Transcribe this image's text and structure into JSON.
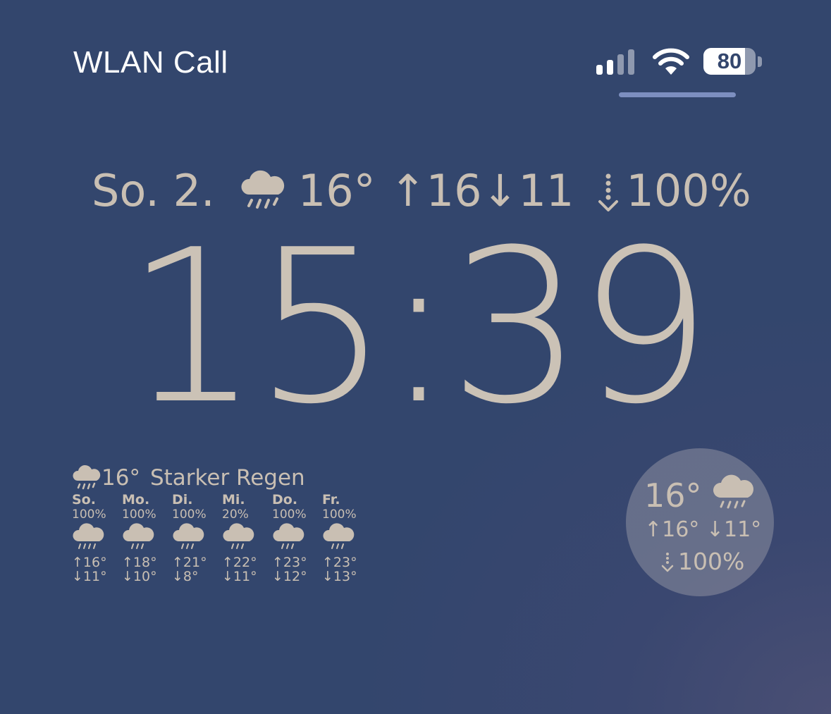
{
  "status_bar": {
    "carrier": "WLAN Call",
    "signal_bars_active": 2,
    "signal_bars_total": 4,
    "battery_level": "80",
    "battery_fraction": 0.8,
    "icons": [
      "cellular-signal-icon",
      "wifi-icon",
      "battery-icon"
    ]
  },
  "top_widget": {
    "date": "So. 2.",
    "icon": "cloud-rain-icon",
    "temp": "16°",
    "high": "↑16",
    "low": "↓11",
    "precip": "100%",
    "precip_icon": "precipitation-arrow-icon"
  },
  "clock": {
    "time": "15:39"
  },
  "forecast_widget": {
    "current_temp": "16°",
    "condition": "Starker Regen",
    "icon": "cloud-rain-icon",
    "days": [
      {
        "day": "So.",
        "precip": "100%",
        "high": "↑16°",
        "low": "↓11°",
        "icon": "cloud-heavy-rain-icon"
      },
      {
        "day": "Mo.",
        "precip": "100%",
        "high": "↑18°",
        "low": "↓10°",
        "icon": "cloud-rain-icon"
      },
      {
        "day": "Di.",
        "precip": "100%",
        "high": "↑21°",
        "low": "↓8°",
        "icon": "cloud-rain-icon"
      },
      {
        "day": "Mi.",
        "precip": "20%",
        "high": "↑22°",
        "low": "↓11°",
        "icon": "cloud-rain-icon"
      },
      {
        "day": "Do.",
        "precip": "100%",
        "high": "↑23°",
        "low": "↓12°",
        "icon": "cloud-rain-icon"
      },
      {
        "day": "Fr.",
        "precip": "100%",
        "high": "↑23°",
        "low": "↓13°",
        "icon": "cloud-rain-icon"
      }
    ]
  },
  "circle_widget": {
    "temp": "16°",
    "hilo": "↑16° ↓11°",
    "precip": "100%",
    "icon": "cloud-rain-icon"
  },
  "colors": {
    "background": "#33466d",
    "widget_text": "#c9bfb3",
    "status_text": "#ffffff"
  }
}
